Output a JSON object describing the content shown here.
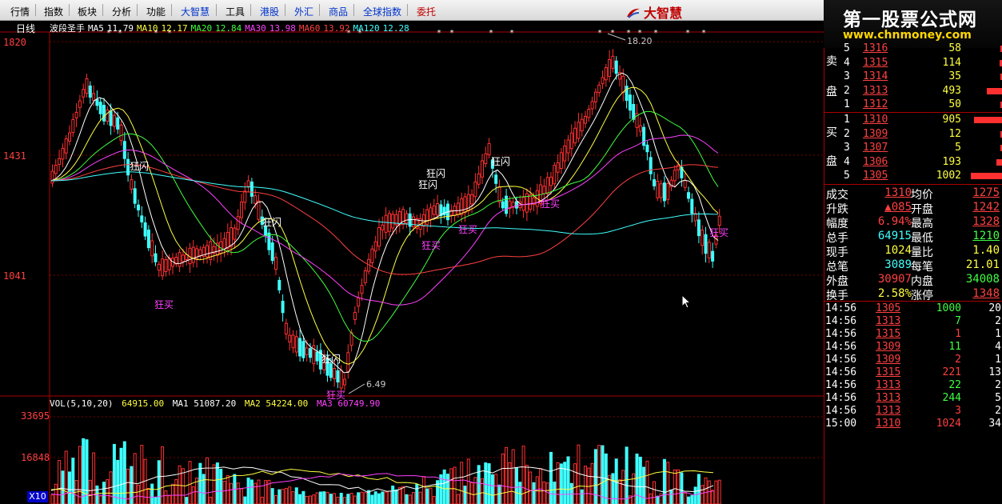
{
  "menu": {
    "items": [
      {
        "label": "行情",
        "style": "normal"
      },
      {
        "label": "指数",
        "style": "normal"
      },
      {
        "label": "板块",
        "style": "normal"
      },
      {
        "label": "分析",
        "style": "normal"
      },
      {
        "label": "功能",
        "style": "normal"
      },
      {
        "label": "大智慧",
        "style": "blue"
      },
      {
        "label": "工具",
        "style": "normal"
      },
      {
        "label": "港股",
        "style": "blue"
      },
      {
        "label": "外汇",
        "style": "blue"
      },
      {
        "label": "商品",
        "style": "blue"
      },
      {
        "label": "全球指数",
        "style": "blue"
      },
      {
        "label": "委托",
        "style": "red"
      }
    ],
    "brand": "大智慧"
  },
  "watermark": {
    "title": "第一股票公式网",
    "url": "www.chnmoney.com"
  },
  "chart": {
    "period": "日线",
    "indicator_name": "波段圣手",
    "ma_legend": [
      {
        "label": "MA5",
        "value": "11.79",
        "color": "#ffffff"
      },
      {
        "label": "MA10",
        "value": "12.17",
        "color": "#ffff40"
      },
      {
        "label": "MA20",
        "value": "12.84",
        "color": "#40ff40"
      },
      {
        "label": "MA30",
        "value": "13.98",
        "color": "#ff40ff"
      },
      {
        "label": "MA60",
        "value": "13.92",
        "color": "#ff4040"
      },
      {
        "label": "MA120",
        "value": "12.28",
        "color": "#40ffff"
      }
    ],
    "price_axis": [
      "1820",
      "1431",
      "1041"
    ],
    "peak_label": "18.20",
    "trough_label": "6.49",
    "annotations": [
      {
        "text": "狂闪",
        "color": "white"
      },
      {
        "text": "狂买",
        "color": "mag"
      },
      {
        "text": "狂闪",
        "color": "white"
      },
      {
        "text": "狂闪",
        "color": "white"
      },
      {
        "text": "狂买",
        "color": "mag"
      },
      {
        "text": "狂闪",
        "color": "white"
      },
      {
        "text": "狂闪",
        "color": "white"
      },
      {
        "text": "狂买",
        "color": "mag"
      },
      {
        "text": "狂买",
        "color": "mag"
      },
      {
        "text": "狂闪",
        "color": "white"
      },
      {
        "text": "狂买",
        "color": "mag"
      },
      {
        "text": "狂买",
        "color": "mag"
      }
    ],
    "volume_legend": {
      "name": "VOL(5,10,20)",
      "vol": "64915.00",
      "ma1": "MA1 51087.20",
      "ma2": "MA2 54224.00",
      "ma3": "MA3 60749.90"
    },
    "volume_axis": [
      "33695",
      "16848"
    ],
    "volume_unit": "X10"
  },
  "orderbook": {
    "sell_label": [
      "卖",
      "盘"
    ],
    "buy_label": [
      "买",
      "盘"
    ],
    "sell": [
      {
        "level": "5",
        "price": "1316",
        "volume": "58",
        "bar": 0.05
      },
      {
        "level": "4",
        "price": "1315",
        "volume": "114",
        "bar": 0.11
      },
      {
        "level": "3",
        "price": "1314",
        "volume": "35",
        "bar": 0.03
      },
      {
        "level": "2",
        "price": "1313",
        "volume": "493",
        "bar": 0.49
      },
      {
        "level": "1",
        "price": "1312",
        "volume": "50",
        "bar": 0.05
      }
    ],
    "buy": [
      {
        "level": "1",
        "price": "1310",
        "volume": "905",
        "bar": 0.9
      },
      {
        "level": "2",
        "price": "1309",
        "volume": "12",
        "bar": 0.01
      },
      {
        "level": "3",
        "price": "1307",
        "volume": "5",
        "bar": 0.01
      },
      {
        "level": "4",
        "price": "1306",
        "volume": "193",
        "bar": 0.19
      },
      {
        "level": "5",
        "price": "1305",
        "volume": "1002",
        "bar": 1.0
      }
    ]
  },
  "stats": [
    {
      "k1": "成交",
      "v1": "1310",
      "c1": "red",
      "u1": true,
      "k2": "均价",
      "v2": "1275",
      "c2": "red",
      "u2": true
    },
    {
      "k1": "升跌",
      "v1": "▲085",
      "c1": "red",
      "u1": true,
      "k2": "开盘",
      "v2": "1242",
      "c2": "red",
      "u2": true
    },
    {
      "k1": "幅度",
      "v1": "6.94%",
      "c1": "red",
      "u1": false,
      "k2": "最高",
      "v2": "1328",
      "c2": "red",
      "u2": true
    },
    {
      "k1": "总手",
      "v1": "64915",
      "c1": "cyan",
      "u1": false,
      "k2": "最低",
      "v2": "1210",
      "c2": "green",
      "u2": true
    },
    {
      "k1": "现手",
      "v1": "1024",
      "c1": "yellow",
      "u1": false,
      "k2": "量比",
      "v2": "1.40",
      "c2": "yellow",
      "u2": false
    },
    {
      "k1": "总笔",
      "v1": "3089",
      "c1": "cyan",
      "u1": false,
      "k2": "每笔",
      "v2": "21.01",
      "c2": "yellow",
      "u2": false
    },
    {
      "k1": "外盘",
      "v1": "30907",
      "c1": "red",
      "u1": false,
      "k2": "内盘",
      "v2": "34008",
      "c2": "green",
      "u2": false
    },
    {
      "k1": "换手",
      "v1": "2.58%",
      "c1": "yellow",
      "u1": false,
      "k2": "涨停",
      "v2": "1348",
      "c2": "red",
      "u2": true
    }
  ],
  "ticks": [
    {
      "time": "14:56",
      "price": "1305",
      "qty": "1000",
      "qc": "green",
      "n": "20"
    },
    {
      "time": "14:56",
      "price": "1313",
      "qty": "7",
      "qc": "green",
      "n": "2"
    },
    {
      "time": "14:56",
      "price": "1315",
      "qty": "1",
      "qc": "red",
      "n": "1"
    },
    {
      "time": "14:56",
      "price": "1309",
      "qty": "11",
      "qc": "green",
      "n": "4"
    },
    {
      "time": "14:56",
      "price": "1309",
      "qty": "2",
      "qc": "red",
      "n": "1"
    },
    {
      "time": "14:56",
      "price": "1315",
      "qty": "221",
      "qc": "red",
      "n": "13"
    },
    {
      "time": "14:56",
      "price": "1313",
      "qty": "22",
      "qc": "green",
      "n": "2"
    },
    {
      "time": "14:56",
      "price": "1313",
      "qty": "244",
      "qc": "green",
      "n": "5"
    },
    {
      "time": "14:56",
      "price": "1313",
      "qty": "3",
      "qc": "red",
      "n": "2"
    },
    {
      "time": "15:00",
      "price": "1310",
      "qty": "1024",
      "qc": "red",
      "n": "34"
    }
  ]
}
